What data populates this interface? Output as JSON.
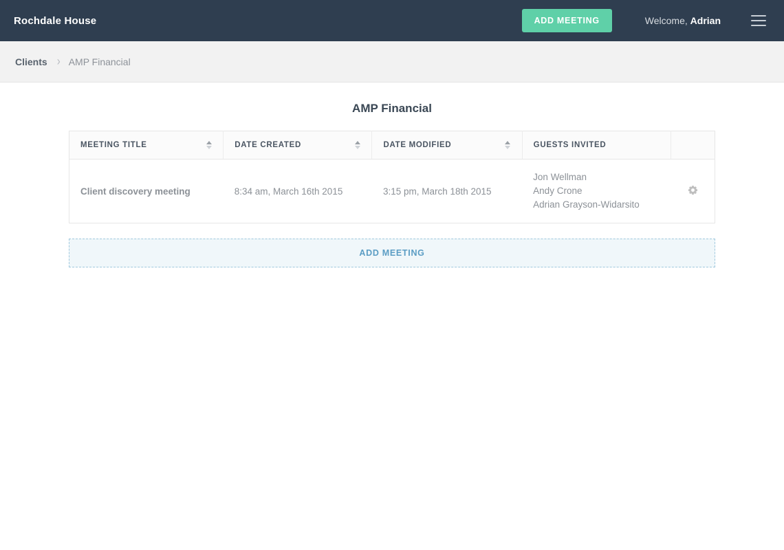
{
  "header": {
    "brand": "Rochdale House",
    "add_meeting_label": "ADD MEETING",
    "welcome_prefix": "Welcome, ",
    "welcome_user": "Adrian",
    "menu_icon": "hamburger-icon",
    "bg_color": "#2f3e50",
    "accent_green": "#5fd0a8"
  },
  "breadcrumb": {
    "parent": "Clients",
    "separator": "›",
    "current": "AMP Financial"
  },
  "main": {
    "page_title": "AMP Financial",
    "table": {
      "columns": [
        {
          "label": "MEETING TITLE",
          "sortable": true
        },
        {
          "label": "DATE CREATED",
          "sortable": true
        },
        {
          "label": "DATE MODIFIED",
          "sortable": true
        },
        {
          "label": "GUESTS INVITED",
          "sortable": false
        },
        {
          "label": "",
          "sortable": false
        }
      ],
      "rows": [
        {
          "title": "Client discovery meeting",
          "date_created": "8:34 am, March 16th 2015",
          "date_modified": "3:15 pm, March 18th 2015",
          "guests": [
            "Jon Wellman",
            "Andy Crone",
            "Adrian Grayson-Widarsito"
          ],
          "action_icon": "gear-icon"
        }
      ]
    },
    "add_meeting_row": {
      "label": "ADD MEETING",
      "link_color": "#5b9dc4",
      "bg_color": "#f0f7fa"
    }
  }
}
